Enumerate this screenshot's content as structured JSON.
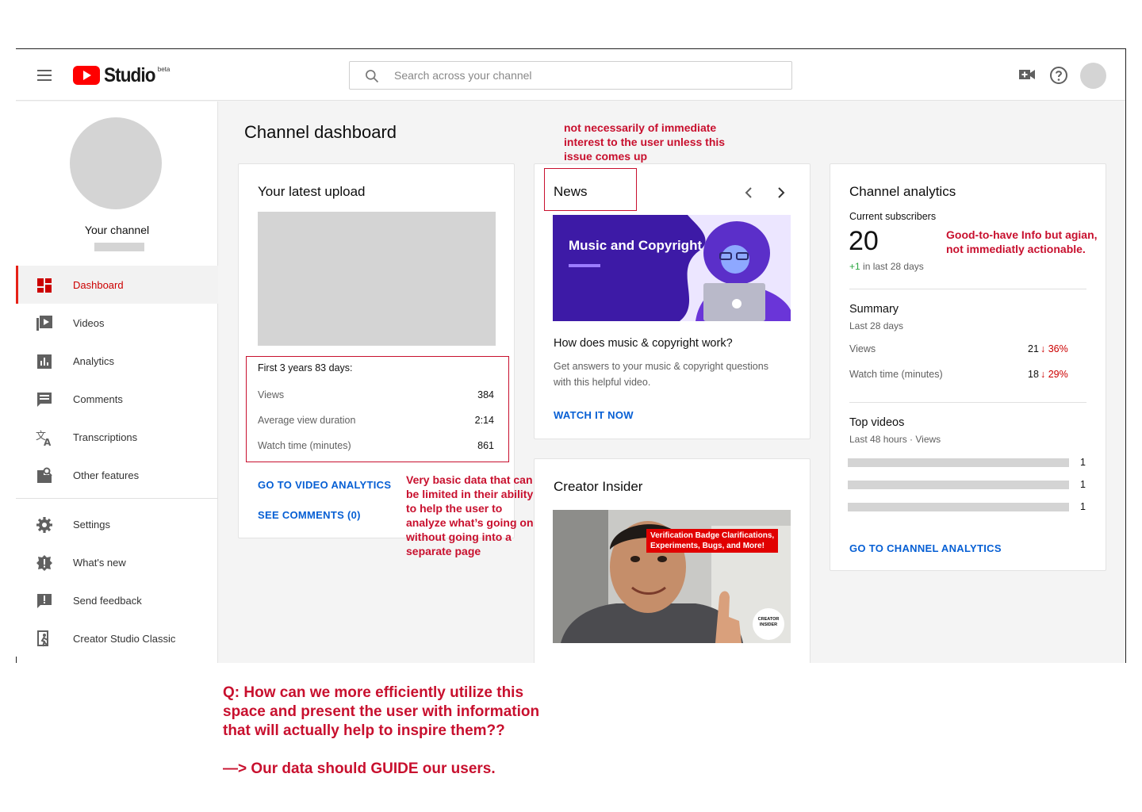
{
  "header": {
    "logo_text": "Studio",
    "logo_badge": "beta",
    "search_placeholder": "Search across your channel"
  },
  "sidebar": {
    "channel_label": "Your channel",
    "items": [
      {
        "label": "Dashboard",
        "icon": "dashboard-icon",
        "active": true
      },
      {
        "label": "Videos",
        "icon": "videos-icon"
      },
      {
        "label": "Analytics",
        "icon": "analytics-icon"
      },
      {
        "label": "Comments",
        "icon": "comments-icon"
      },
      {
        "label": "Transcriptions",
        "icon": "transcriptions-icon"
      },
      {
        "label": "Other features",
        "icon": "other-features-icon"
      },
      {
        "label": "Settings",
        "icon": "settings-icon"
      },
      {
        "label": "What's new",
        "icon": "whats-new-icon"
      },
      {
        "label": "Send feedback",
        "icon": "feedback-icon"
      },
      {
        "label": "Creator Studio Classic",
        "icon": "classic-icon"
      }
    ]
  },
  "main": {
    "page_title": "Channel dashboard",
    "latest_upload": {
      "title": "Your latest upload",
      "period": "First 3 years 83 days:",
      "stats": [
        {
          "label": "Views",
          "value": "384"
        },
        {
          "label": "Average view duration",
          "value": "2:14"
        },
        {
          "label": "Watch time (minutes)",
          "value": "861"
        }
      ],
      "link_analytics": "GO TO VIDEO ANALYTICS",
      "link_comments": "SEE COMMENTS (0)"
    },
    "news": {
      "title": "News",
      "banner_text": "Music and Copyright",
      "headline": "How does music & copyright work?",
      "body": "Get answers to your music & copyright questions with this helpful video.",
      "link": "WATCH IT NOW"
    },
    "creator_insider": {
      "title": "Creator Insider",
      "thumb_caption_1": "Verification Badge Clarifications,",
      "thumb_caption_2": "Experiments, Bugs, and More!",
      "badge_line_1": "CREATOR",
      "badge_line_2": "INSIDER"
    },
    "channel_analytics": {
      "title": "Channel analytics",
      "subs_label": "Current subscribers",
      "subs_value": "20",
      "subs_change": "+1",
      "subs_change_suffix": "in last 28 days",
      "summary_title": "Summary",
      "summary_period": "Last 28 days",
      "summary_rows": [
        {
          "label": "Views",
          "value": "21",
          "change": "36%"
        },
        {
          "label": "Watch time (minutes)",
          "value": "18",
          "change": "29%"
        }
      ],
      "top_title": "Top videos",
      "top_period": "Last 48 hours · Views",
      "top_rows": [
        {
          "value": "1"
        },
        {
          "value": "1"
        },
        {
          "value": "1"
        }
      ],
      "link": "GO TO CHANNEL ANALYTICS"
    }
  },
  "annotations": {
    "news_note": "not necessarily of immediate interest to the user unless this issue comes up",
    "analytics_note": "Good-to-have Info but agian, not immediatly actionable.",
    "upload_note": "Very basic data that can be limited in their ability to help the user to analyze what’s going on without going into a separate page",
    "question": "Q: How can we more efficiently utilize this space and present the user with information that will actually help to inspire them??",
    "conclusion": "—> Our data should GUIDE our users."
  },
  "colors": {
    "brand_red": "#ff0000",
    "link_blue": "#065fd4",
    "annotation_red": "#c8102e",
    "positive_green": "#2ba640"
  }
}
